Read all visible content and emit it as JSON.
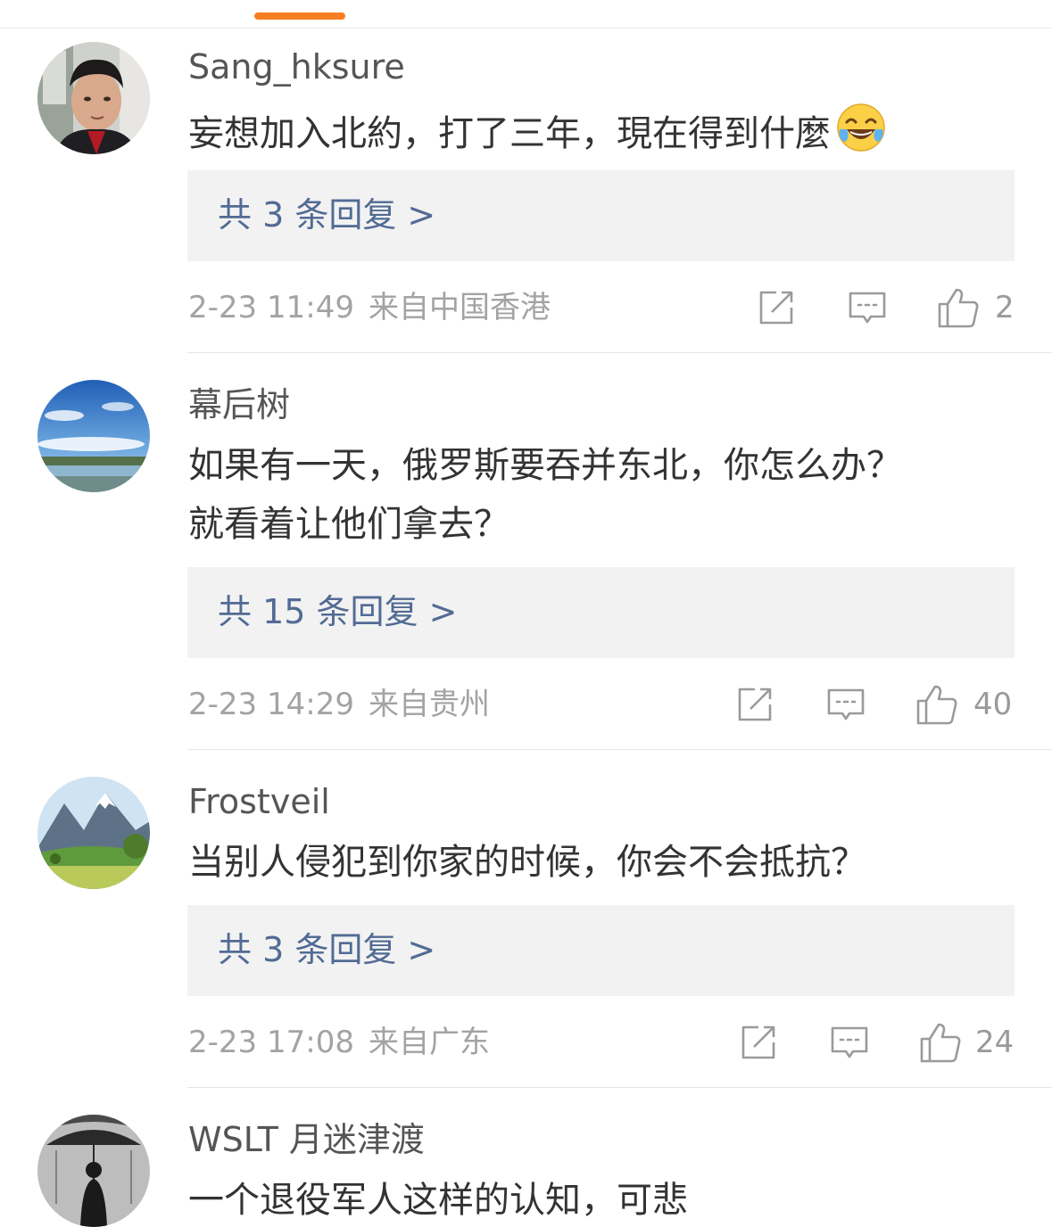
{
  "colors": {
    "tab_indicator": "#f77e23",
    "reply_link": "#526b94",
    "meta_text": "#a3a3a3",
    "reply_box_bg": "#f2f2f2"
  },
  "icons": {
    "forward": "forward-icon",
    "comment": "comment-icon",
    "like": "thumbs-up-icon",
    "emoji": "laughing-tears-emoji"
  },
  "comments": [
    {
      "username": "Sang_hksure",
      "text_lines": [
        "妄想加入北約，打了三年，現在得到什麼"
      ],
      "reply_link": "共 3 条回复 >",
      "time": "2-23 11:49",
      "location": "来自中国香港",
      "likes": "2"
    },
    {
      "username": "幕后树",
      "text_lines": [
        "如果有一天，俄罗斯要吞并东北，你怎么办？",
        "就看着让他们拿去？"
      ],
      "reply_link": "共 15 条回复 >",
      "time": "2-23 14:29",
      "location": "来自贵州",
      "likes": "40"
    },
    {
      "username": "Frostveil",
      "text_lines": [
        "当别人侵犯到你家的时候，你会不会抵抗？"
      ],
      "reply_link": "共 3 条回复 >",
      "time": "2-23 17:08",
      "location": "来自广东",
      "likes": "24"
    },
    {
      "username": "WSLT 月迷津渡",
      "text_lines": [
        "一个退役军人这样的认知，可悲"
      ]
    }
  ]
}
